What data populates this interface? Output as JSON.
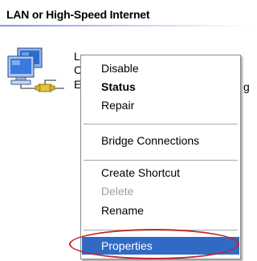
{
  "section": {
    "header": "LAN or High-Speed Internet"
  },
  "connection": {
    "icon": "network-connection-icon",
    "label_fragments": [
      "L",
      "C",
      "E",
      "g"
    ]
  },
  "context_menu": {
    "items": [
      {
        "label": "Disable",
        "bold": false,
        "enabled": true
      },
      {
        "label": "Status",
        "bold": true,
        "enabled": true
      },
      {
        "label": "Repair",
        "bold": false,
        "enabled": true
      },
      {
        "label": "Bridge Connections",
        "bold": false,
        "enabled": true
      },
      {
        "label": "Create Shortcut",
        "bold": false,
        "enabled": true
      },
      {
        "label": "Delete",
        "bold": false,
        "enabled": false
      },
      {
        "label": "Rename",
        "bold": false,
        "enabled": true
      },
      {
        "label": "Properties",
        "bold": false,
        "enabled": true,
        "selected": true
      }
    ],
    "selection_color": "#316ac5",
    "annotation_color": "#c0262a"
  }
}
